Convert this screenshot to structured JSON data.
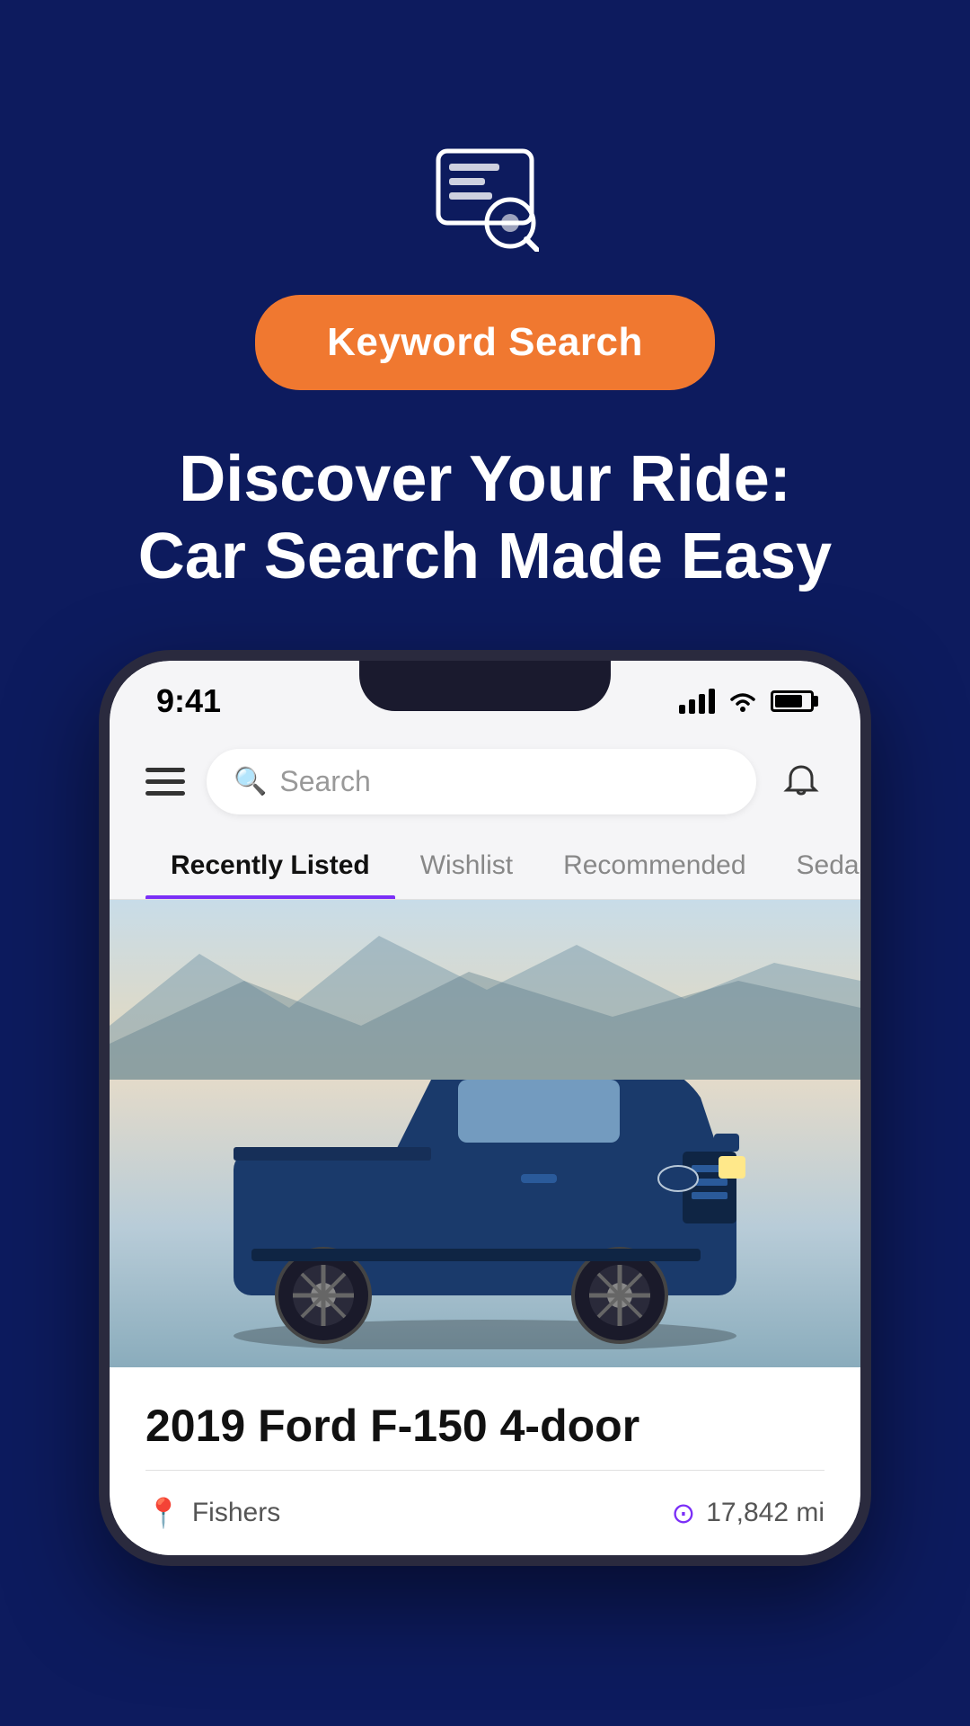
{
  "background_color": "#0d1b5e",
  "hero": {
    "keyword_button_label": "Keyword Search",
    "title_line1": "Discover Your Ride:",
    "title_line2": "Car Search Made Easy"
  },
  "phone": {
    "status_bar": {
      "time": "9:41",
      "signal": "signal",
      "wifi": "wifi",
      "battery": "battery"
    },
    "header": {
      "search_placeholder": "Search",
      "hamburger_label": "menu",
      "bell_label": "notifications"
    },
    "tabs": [
      {
        "label": "Recently Listed",
        "active": true
      },
      {
        "label": "Wishlist",
        "active": false
      },
      {
        "label": "Recommended",
        "active": false
      },
      {
        "label": "Sedans",
        "active": false
      }
    ],
    "car_listing": {
      "title": "2019 Ford F-150 4-door",
      "location": "Fishers",
      "mileage": "17,842 mi"
    }
  }
}
